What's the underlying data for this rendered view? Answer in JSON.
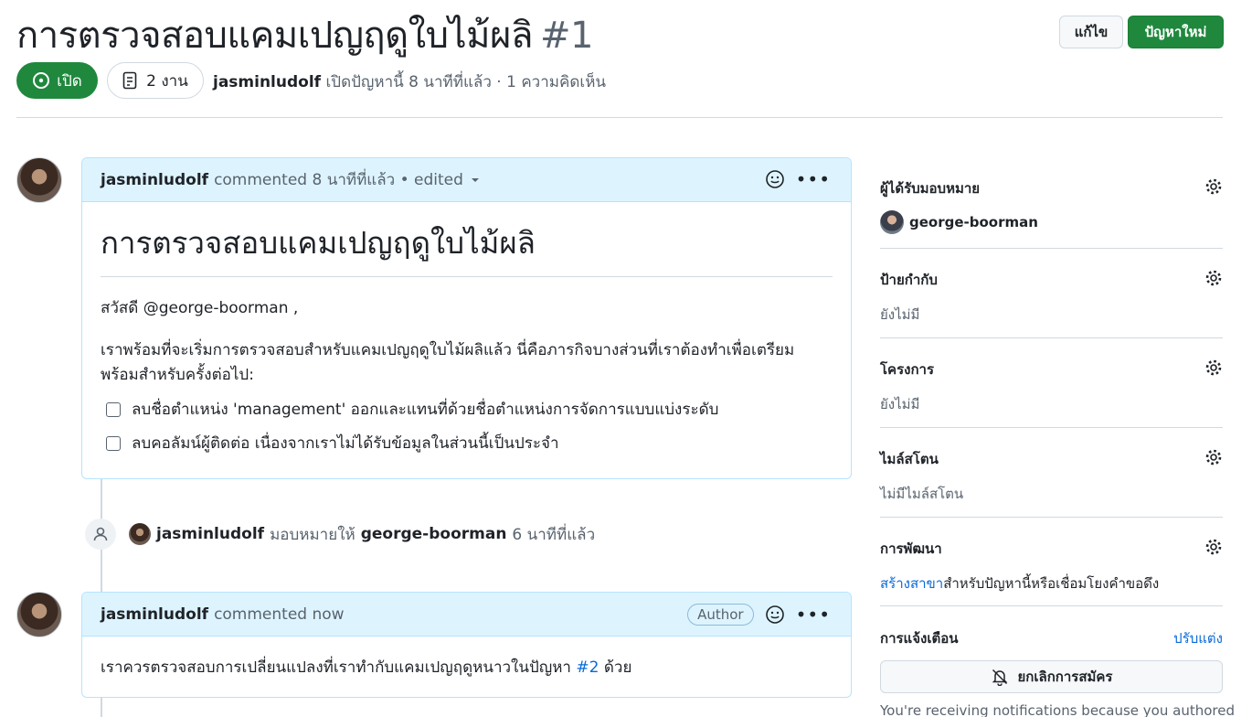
{
  "header": {
    "title": "การตรวจสอบแคมเปญฤดูใบไม้ผลิ",
    "number": "#1",
    "edit_label": "แก้ไข",
    "new_issue_label": "ปัญหาใหม่",
    "state_label": "เปิด",
    "tasks_label": "2 งาน",
    "author": "jasminludolf",
    "meta_text": "เปิดปัญหานี้ 8 นาทีที่แล้ว · 1 ความคิดเห็น"
  },
  "comment1": {
    "author": "jasminludolf",
    "meta": "commented 8 นาทีที่แล้ว • edited",
    "heading": "การตรวจสอบแคมเปญฤดูใบไม้ผลิ",
    "greeting": "สวัสดี @george-boorman ,",
    "body_line1": "เราพร้อมที่จะเริ่มการตรวจสอบสำหรับแคมเปญฤดูใบไม้ผลิแล้ว นี่คือภารกิจบางส่วนที่เราต้องทำเพื่อเตรียม",
    "body_line2": "พร้อมสำหรับครั้งต่อไป:",
    "tasks": [
      "ลบชื่อตำแหน่ง 'management' ออกและแทนที่ด้วยชื่อตำแหน่งการจัดการแบบแบ่งระดับ",
      "ลบคอลัมน์ผู้ติดต่อ เนื่องจากเราไม่ได้รับข้อมูลในส่วนนี้เป็นประจำ"
    ]
  },
  "event": {
    "actor": "jasminludolf",
    "action": "มอบหมายให้",
    "target": "george-boorman",
    "time": "6 นาทีที่แล้ว"
  },
  "comment2": {
    "author": "jasminludolf",
    "meta": "commented now",
    "badge": "Author",
    "text_before": "เราควรตรวจสอบการเปลี่ยนแปลงที่เราทำกับแคมเปญฤดูหนาวในปัญหา",
    "link": "#2",
    "text_after": "ด้วย"
  },
  "sidebar": {
    "assignees_title": "ผู้ได้รับมอบหมาย",
    "assignee": "george-boorman",
    "labels_title": "ป้ายกำกับ",
    "labels_value": "ยังไม่มี",
    "projects_title": "โครงการ",
    "projects_value": "ยังไม่มี",
    "milestone_title": "ไมล์สโตน",
    "milestone_value": "ไม่มีไมล์สโตน",
    "development_title": "การพัฒนา",
    "development_link": "สร้างสาขา",
    "development_text": "สำหรับปัญหานี้หรือเชื่อมโยงคำขอดึง",
    "notifications_title": "การแจ้งเตือน",
    "customize_label": "ปรับแต่ง",
    "unsubscribe_label": "ยกเลิกการสมัคร",
    "notif_note": "You're receiving notifications because you authored"
  }
}
